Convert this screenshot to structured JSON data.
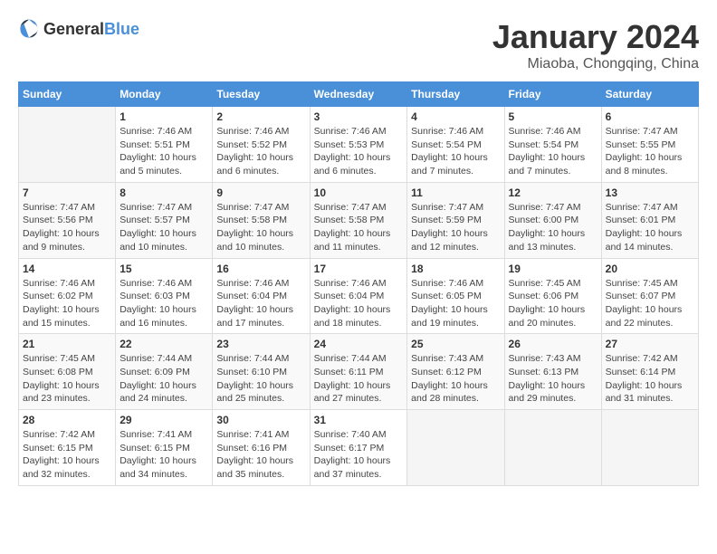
{
  "header": {
    "logo_general": "General",
    "logo_blue": "Blue",
    "title": "January 2024",
    "location": "Miaoba, Chongqing, China"
  },
  "calendar": {
    "days_of_week": [
      "Sunday",
      "Monday",
      "Tuesday",
      "Wednesday",
      "Thursday",
      "Friday",
      "Saturday"
    ],
    "weeks": [
      [
        {
          "day": "",
          "info": ""
        },
        {
          "day": "1",
          "info": "Sunrise: 7:46 AM\nSunset: 5:51 PM\nDaylight: 10 hours\nand 5 minutes."
        },
        {
          "day": "2",
          "info": "Sunrise: 7:46 AM\nSunset: 5:52 PM\nDaylight: 10 hours\nand 6 minutes."
        },
        {
          "day": "3",
          "info": "Sunrise: 7:46 AM\nSunset: 5:53 PM\nDaylight: 10 hours\nand 6 minutes."
        },
        {
          "day": "4",
          "info": "Sunrise: 7:46 AM\nSunset: 5:54 PM\nDaylight: 10 hours\nand 7 minutes."
        },
        {
          "day": "5",
          "info": "Sunrise: 7:46 AM\nSunset: 5:54 PM\nDaylight: 10 hours\nand 7 minutes."
        },
        {
          "day": "6",
          "info": "Sunrise: 7:47 AM\nSunset: 5:55 PM\nDaylight: 10 hours\nand 8 minutes."
        }
      ],
      [
        {
          "day": "7",
          "info": "Sunrise: 7:47 AM\nSunset: 5:56 PM\nDaylight: 10 hours\nand 9 minutes."
        },
        {
          "day": "8",
          "info": "Sunrise: 7:47 AM\nSunset: 5:57 PM\nDaylight: 10 hours\nand 10 minutes."
        },
        {
          "day": "9",
          "info": "Sunrise: 7:47 AM\nSunset: 5:58 PM\nDaylight: 10 hours\nand 10 minutes."
        },
        {
          "day": "10",
          "info": "Sunrise: 7:47 AM\nSunset: 5:58 PM\nDaylight: 10 hours\nand 11 minutes."
        },
        {
          "day": "11",
          "info": "Sunrise: 7:47 AM\nSunset: 5:59 PM\nDaylight: 10 hours\nand 12 minutes."
        },
        {
          "day": "12",
          "info": "Sunrise: 7:47 AM\nSunset: 6:00 PM\nDaylight: 10 hours\nand 13 minutes."
        },
        {
          "day": "13",
          "info": "Sunrise: 7:47 AM\nSunset: 6:01 PM\nDaylight: 10 hours\nand 14 minutes."
        }
      ],
      [
        {
          "day": "14",
          "info": "Sunrise: 7:46 AM\nSunset: 6:02 PM\nDaylight: 10 hours\nand 15 minutes."
        },
        {
          "day": "15",
          "info": "Sunrise: 7:46 AM\nSunset: 6:03 PM\nDaylight: 10 hours\nand 16 minutes."
        },
        {
          "day": "16",
          "info": "Sunrise: 7:46 AM\nSunset: 6:04 PM\nDaylight: 10 hours\nand 17 minutes."
        },
        {
          "day": "17",
          "info": "Sunrise: 7:46 AM\nSunset: 6:04 PM\nDaylight: 10 hours\nand 18 minutes."
        },
        {
          "day": "18",
          "info": "Sunrise: 7:46 AM\nSunset: 6:05 PM\nDaylight: 10 hours\nand 19 minutes."
        },
        {
          "day": "19",
          "info": "Sunrise: 7:45 AM\nSunset: 6:06 PM\nDaylight: 10 hours\nand 20 minutes."
        },
        {
          "day": "20",
          "info": "Sunrise: 7:45 AM\nSunset: 6:07 PM\nDaylight: 10 hours\nand 22 minutes."
        }
      ],
      [
        {
          "day": "21",
          "info": "Sunrise: 7:45 AM\nSunset: 6:08 PM\nDaylight: 10 hours\nand 23 minutes."
        },
        {
          "day": "22",
          "info": "Sunrise: 7:44 AM\nSunset: 6:09 PM\nDaylight: 10 hours\nand 24 minutes."
        },
        {
          "day": "23",
          "info": "Sunrise: 7:44 AM\nSunset: 6:10 PM\nDaylight: 10 hours\nand 25 minutes."
        },
        {
          "day": "24",
          "info": "Sunrise: 7:44 AM\nSunset: 6:11 PM\nDaylight: 10 hours\nand 27 minutes."
        },
        {
          "day": "25",
          "info": "Sunrise: 7:43 AM\nSunset: 6:12 PM\nDaylight: 10 hours\nand 28 minutes."
        },
        {
          "day": "26",
          "info": "Sunrise: 7:43 AM\nSunset: 6:13 PM\nDaylight: 10 hours\nand 29 minutes."
        },
        {
          "day": "27",
          "info": "Sunrise: 7:42 AM\nSunset: 6:14 PM\nDaylight: 10 hours\nand 31 minutes."
        }
      ],
      [
        {
          "day": "28",
          "info": "Sunrise: 7:42 AM\nSunset: 6:15 PM\nDaylight: 10 hours\nand 32 minutes."
        },
        {
          "day": "29",
          "info": "Sunrise: 7:41 AM\nSunset: 6:15 PM\nDaylight: 10 hours\nand 34 minutes."
        },
        {
          "day": "30",
          "info": "Sunrise: 7:41 AM\nSunset: 6:16 PM\nDaylight: 10 hours\nand 35 minutes."
        },
        {
          "day": "31",
          "info": "Sunrise: 7:40 AM\nSunset: 6:17 PM\nDaylight: 10 hours\nand 37 minutes."
        },
        {
          "day": "",
          "info": ""
        },
        {
          "day": "",
          "info": ""
        },
        {
          "day": "",
          "info": ""
        }
      ]
    ]
  }
}
